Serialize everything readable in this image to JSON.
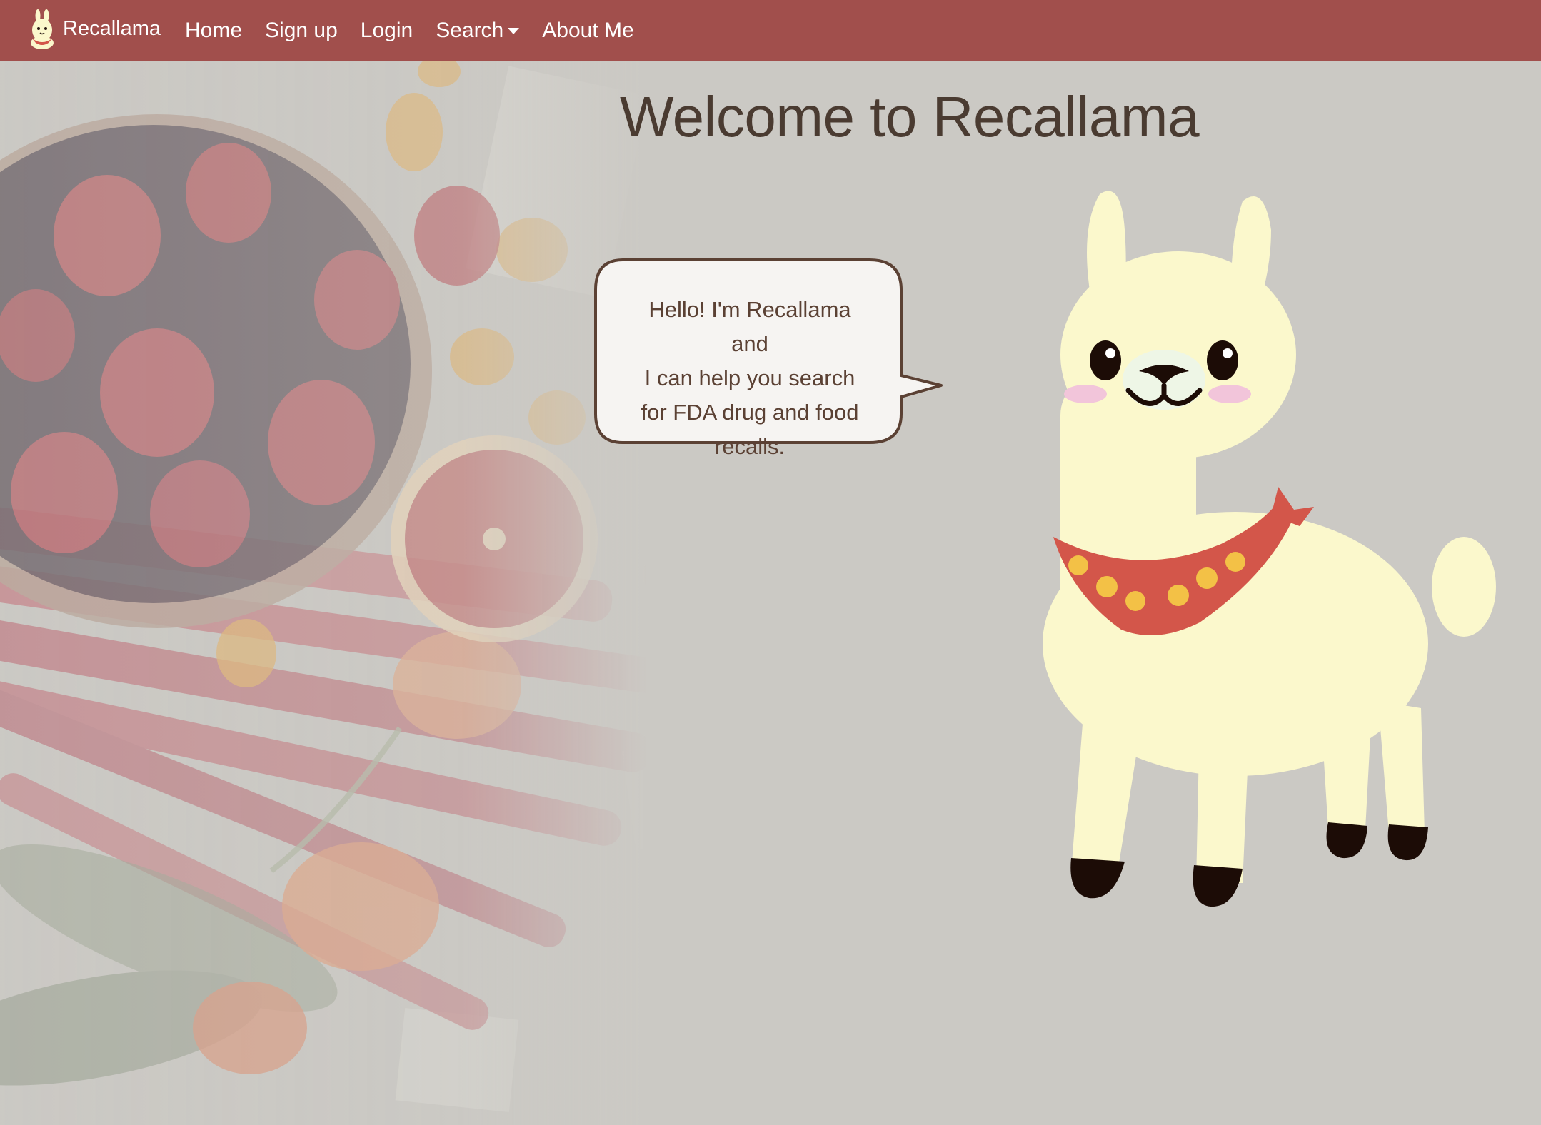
{
  "navbar": {
    "brand_label": "Recallama",
    "links": [
      {
        "label": "Home"
      },
      {
        "label": "Sign up"
      },
      {
        "label": "Login"
      },
      {
        "label": "Search",
        "has_dropdown": true
      },
      {
        "label": "About Me"
      }
    ],
    "background_color": "#a14f4c"
  },
  "main": {
    "title": "Welcome to Recallama",
    "speech_bubble": {
      "lines": [
        "Hello! I'm Recallama",
        "and",
        "I can help you search",
        "for FDA drug and food",
        "recalls."
      ]
    }
  },
  "icons": {
    "brand_logo": "llama-logo-icon",
    "search_dropdown": "caret-down-icon"
  },
  "colors": {
    "title_text": "#4a3b31",
    "bubble_text": "#5b4134",
    "bubble_border": "#5b4134",
    "bubble_fill": "#f6f4f2",
    "llama_body": "#fbf8cc",
    "bandana": "#d3564a"
  }
}
